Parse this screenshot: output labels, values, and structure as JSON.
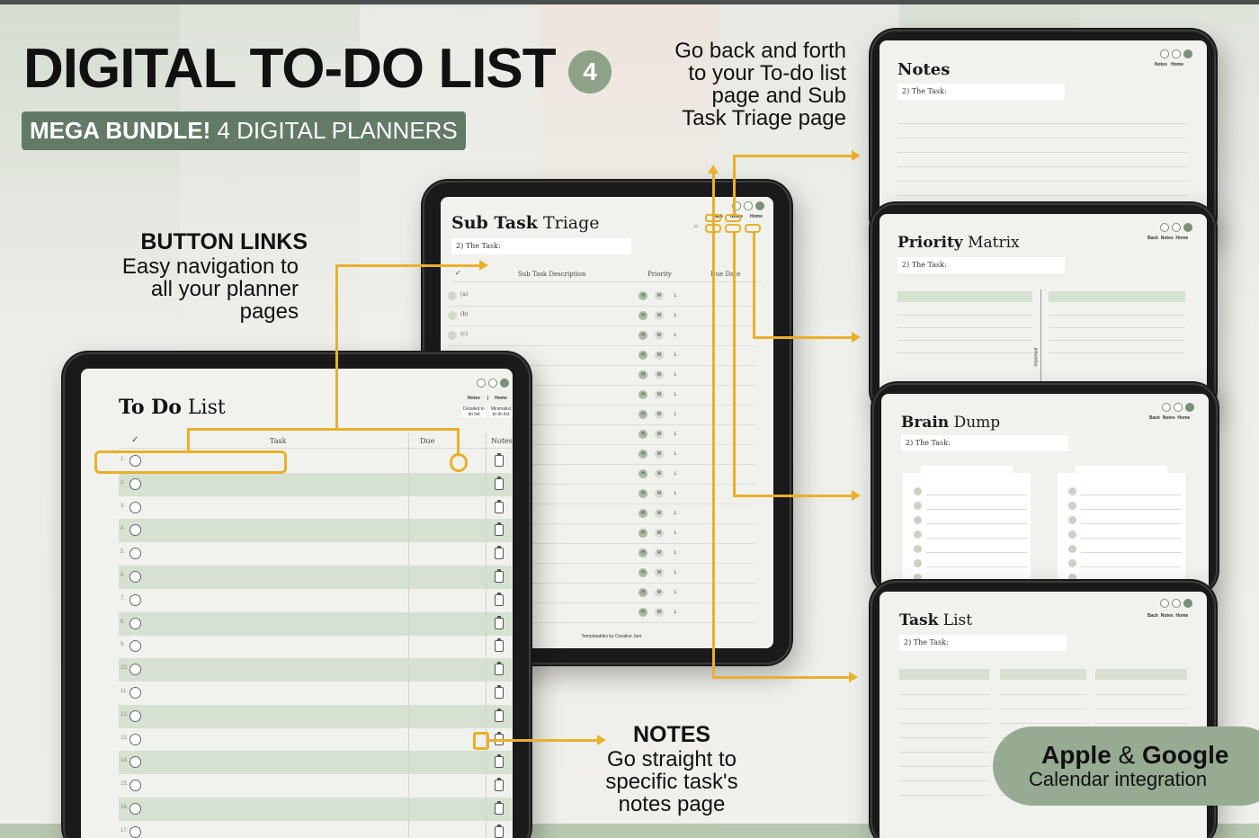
{
  "hero": {
    "title": "DIGITAL TO-DO LIST",
    "badge": "4",
    "bundle_bold": "MEGA BUNDLE!",
    "bundle_rest": " 4 DIGITAL PLANNERS"
  },
  "callouts": {
    "button_links": {
      "heading": "BUTTON LINKS",
      "lines": [
        "Easy navigation to",
        "all your planner",
        "pages"
      ]
    },
    "back_forth": {
      "lines": [
        "Go back and forth",
        "to your To-do list",
        "page and Sub",
        "Task Triage page"
      ]
    },
    "notes": {
      "heading": "NOTES",
      "lines": [
        "Go straight to",
        "specific task's",
        "notes page"
      ]
    }
  },
  "calendar": {
    "apple": "Apple",
    "amp": " & ",
    "google": "Google",
    "sub": "Calendar integration"
  },
  "todo": {
    "title_bold": "To Do",
    "title_rest": " List",
    "col_check": "✓",
    "col_task": "Task",
    "col_due": "Due",
    "col_notes": "Notes",
    "tab_notes": "Notes",
    "tab_sep": "|",
    "tab_home": "Home",
    "mini_a": "Detailed to do list",
    "mini_b": "Minimalist to do list",
    "rows": [
      "1.",
      "2.",
      "3.",
      "4.",
      "5.",
      "6.",
      "7.",
      "8.",
      "9.",
      "10.",
      "11.",
      "12.",
      "13.",
      "14.",
      "15.",
      "16.",
      "17."
    ]
  },
  "subtask": {
    "title_bold": "Sub Task",
    "title_rest": " Triage",
    "task": "2) The Task:",
    "col_check": "✓",
    "col_desc": "Sub Task Description",
    "col_priority": "Priority",
    "col_due": "Due Date",
    "tab_back": "Back",
    "tab_notes": "Notes",
    "tab_home": "Home",
    "rows": [
      "(a)",
      "(b)",
      "(c)",
      "",
      "",
      "",
      "",
      "",
      "",
      "",
      "",
      "",
      "",
      "",
      "",
      "",
      ""
    ],
    "prio": [
      "H",
      "M",
      "L"
    ],
    "footer": "Templatables by Creative Jam"
  },
  "pages": {
    "notes": {
      "title_bold": "Notes",
      "title_rest": "",
      "task": "2) The Task:",
      "tabs": [
        "Notes",
        "Home"
      ]
    },
    "priority": {
      "title_bold": "Priority",
      "title_rest": " Matrix",
      "task": "2) The Task:",
      "axis": "Important",
      "tabs": [
        "Back",
        "Notes",
        "Home"
      ]
    },
    "brain": {
      "title_bold": "Brain",
      "title_rest": " Dump",
      "task": "2) The Task:",
      "tabs": [
        "Back",
        "Notes",
        "Home"
      ]
    },
    "tasklist": {
      "title_bold": "Task",
      "title_rest": " List",
      "task": "2) The Task:",
      "tabs": [
        "Back",
        "Notes",
        "Home"
      ]
    }
  }
}
